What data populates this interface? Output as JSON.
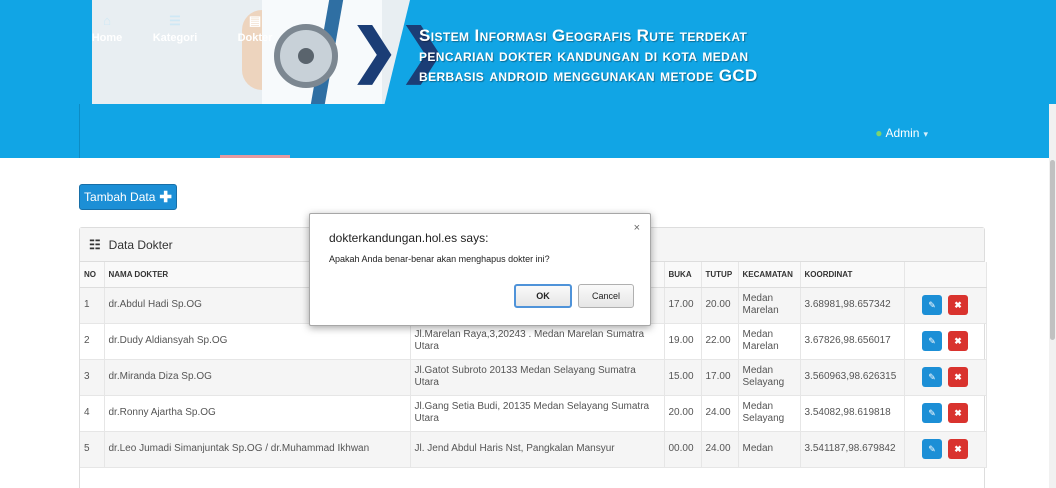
{
  "banner": {
    "title_lines": [
      "Sistem Informasi Geografis  Rute terdekat",
      "pencarian dokter kandungan di kota medan",
      "berbasis android menggunakan metode GCD"
    ],
    "chevron_glyph": "❯❯"
  },
  "nav": {
    "items": [
      {
        "label": "Home",
        "icon": "home-icon",
        "glyph": "⌂"
      },
      {
        "label": "Kategori",
        "icon": "list-icon",
        "glyph": "☰"
      },
      {
        "label": "Dokter",
        "icon": "doctor-window-icon",
        "glyph": "▤"
      }
    ],
    "active": "Dokter",
    "user": {
      "name": "Admin",
      "caret": "▾",
      "glyph": "●"
    }
  },
  "toolbar": {
    "add_label": "Tambah Data",
    "add_icon": "plus-icon",
    "add_glyph": "✚"
  },
  "panel": {
    "title": "Data Dokter",
    "title_icon": "list-icon",
    "title_glyph": "☷",
    "columns": [
      "NO",
      "NAMA DOKTER",
      "",
      "BUKA",
      "TUTUP",
      "KECAMATAN",
      "KOORDINAT",
      ""
    ],
    "rows": [
      {
        "no": "1",
        "nama": "dr.Abdul Hadi Sp.OG",
        "alamat": "",
        "buka": "17.00",
        "tutup": "20.00",
        "kecamatan": "Medan Marelan",
        "koordinat": "3.68981,98.657342"
      },
      {
        "no": "2",
        "nama": "dr.Dudy Aldiansyah Sp.OG",
        "alamat": "Jl.Marelan Raya,3,20243 . Medan Marelan Sumatra Utara",
        "buka": "19.00",
        "tutup": "22.00",
        "kecamatan": "Medan Marelan",
        "koordinat": "3.67826,98.656017"
      },
      {
        "no": "3",
        "nama": "dr.Miranda Diza Sp.OG",
        "alamat": "Jl.Gatot Subroto 20133 Medan Selayang Sumatra Utara",
        "buka": "15.00",
        "tutup": "17.00",
        "kecamatan": "Medan Selayang",
        "koordinat": "3.560963,98.626315"
      },
      {
        "no": "4",
        "nama": "dr.Ronny Ajartha Sp.OG",
        "alamat": "Jl.Gang Setia Budi, 20135 Medan Selayang Sumatra Utara",
        "buka": "20.00",
        "tutup": "24.00",
        "kecamatan": "Medan Selayang",
        "koordinat": "3.54082,98.619818"
      },
      {
        "no": "5",
        "nama": "dr.Leo Jumadi Simanjuntak Sp.OG / dr.Muhammad Ikhwan",
        "alamat": "Jl. Jend Abdul Haris Nst, Pangkalan Mansyur",
        "buka": "00.00",
        "tutup": "24.00",
        "kecamatan": "Medan",
        "koordinat": "3.541187,98.679842"
      }
    ],
    "edit_glyph": "✎",
    "delete_glyph": "✖"
  },
  "dialog": {
    "title": "dokterkandungan.hol.es says:",
    "message": "Apakah Anda benar-benar akan menghapus dokter ini?",
    "ok_label": "OK",
    "cancel_label": "Cancel",
    "close_glyph": "×"
  },
  "colors": {
    "header_blue": "#11a5e5",
    "primary": "#1c8fd6",
    "danger": "#d9332e",
    "banner_navy": "#1b3d76",
    "active_underline": "#e59aa0"
  }
}
